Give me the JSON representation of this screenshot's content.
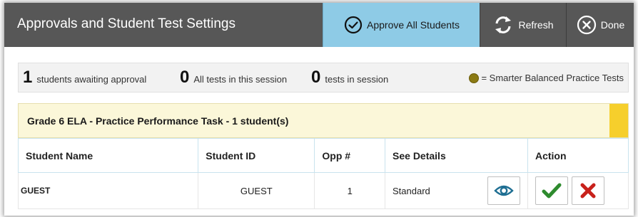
{
  "header": {
    "title": "Approvals and Student Test Settings",
    "approve_all_label": "Approve All Students",
    "refresh_label": "Refresh",
    "done_label": "Done",
    "approve_icon": "check-circle-icon",
    "refresh_icon": "refresh-icon",
    "done_icon": "close-circle-icon"
  },
  "summary": {
    "awaiting_count": "1",
    "awaiting_label": "students awaiting approval",
    "all_tests_count": "0",
    "all_tests_label": "All tests in this session",
    "tests_count": "0",
    "tests_label": "tests in session",
    "legend_label": "= Smarter Balanced Practice Tests",
    "legend_color": "#8b7a14"
  },
  "group": {
    "title": "Grade 6 ELA - Practice Performance Task - 1 student(s)",
    "flag_color": "#f6cf2c"
  },
  "table": {
    "columns": [
      "Student Name",
      "Student ID",
      "Opp #",
      "See Details",
      "Action"
    ],
    "rows": [
      {
        "name": "GUEST",
        "id": "GUEST",
        "opp": "1",
        "details": "Standard"
      }
    ]
  },
  "colors": {
    "header_bg": "#575757",
    "approve_bg": "#8ecbe6",
    "approve_check": "#2e8b2e",
    "deny_x": "#c8211b",
    "view_eye": "#1f6f93"
  }
}
